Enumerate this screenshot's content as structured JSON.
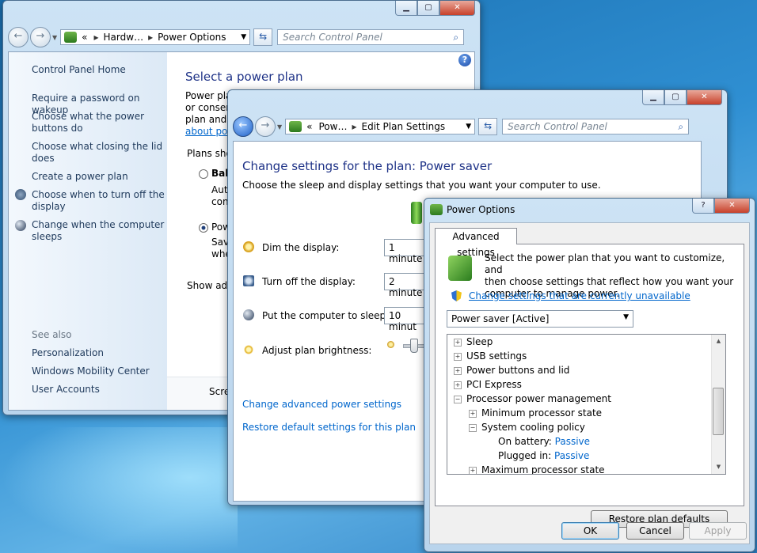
{
  "win1": {
    "address": [
      "«",
      "Hardw…",
      "Power Options"
    ],
    "search_placeholder": "Search Control Panel",
    "sidebar": {
      "home": "Control Panel Home",
      "links": [
        "Require a password on wakeup",
        "Choose what the power buttons do",
        "Choose what closing the lid does",
        "Create a power plan",
        "Choose when to turn off the display",
        "Change when the computer sleeps"
      ],
      "see_also": "See also",
      "see_also_links": [
        "Personalization",
        "Windows Mobility Center",
        "User Accounts"
      ]
    },
    "main": {
      "title": "Select a power plan",
      "desc_lines": [
        "Power plan",
        "or conserv",
        "plan and c"
      ],
      "about_link": "about pow",
      "plans_label": "Plans show",
      "plan1": "Bala",
      "plan1_desc": [
        "Auto",
        "cons"
      ],
      "plan2": "Pow",
      "plan2_desc": [
        "Save",
        "whe"
      ],
      "show_add": "Show add",
      "screen": "Scre"
    }
  },
  "win2": {
    "address": [
      "«",
      "Pow…",
      "Edit Plan Settings"
    ],
    "search_placeholder": "Search Control Panel",
    "title": "Change settings for the plan: Power saver",
    "subtitle": "Choose the sleep and display settings that you want your computer to use.",
    "rows": [
      {
        "label": "Dim the display:",
        "value": "1 minute"
      },
      {
        "label": "Turn off the display:",
        "value": "2 minute"
      },
      {
        "label": "Put the computer to sleep:",
        "value": "10 minut"
      },
      {
        "label": "Adjust plan brightness:",
        "value": ""
      }
    ],
    "advanced_link": "Change advanced power settings",
    "restore_link": "Restore default settings for this plan"
  },
  "dialog": {
    "title": "Power Options",
    "help": "?",
    "tab": "Advanced settings",
    "intro": [
      "Select the power plan that you want to customize, and",
      "then choose settings that reflect how you want your",
      "computer to manage power."
    ],
    "change_link": "Change settings that are currently unavailable",
    "plan_select": "Power saver [Active]",
    "tree": [
      {
        "label": "Sleep",
        "level": 0,
        "exp": "+"
      },
      {
        "label": "USB settings",
        "level": 0,
        "exp": "+"
      },
      {
        "label": "Power buttons and lid",
        "level": 0,
        "exp": "+"
      },
      {
        "label": "PCI Express",
        "level": 0,
        "exp": "+"
      },
      {
        "label": "Processor power management",
        "level": 0,
        "exp": "−"
      },
      {
        "label": "Minimum processor state",
        "level": 1,
        "exp": "+"
      },
      {
        "label": "System cooling policy",
        "level": 1,
        "exp": "−"
      },
      {
        "label": "On battery:",
        "level": 2,
        "value": "Passive"
      },
      {
        "label": "Plugged in:",
        "level": 2,
        "value": "Passive"
      },
      {
        "label": "Maximum processor state",
        "level": 1,
        "exp": "+"
      }
    ],
    "restore_btn": "Restore plan defaults",
    "ok": "OK",
    "cancel": "Cancel",
    "apply": "Apply"
  }
}
